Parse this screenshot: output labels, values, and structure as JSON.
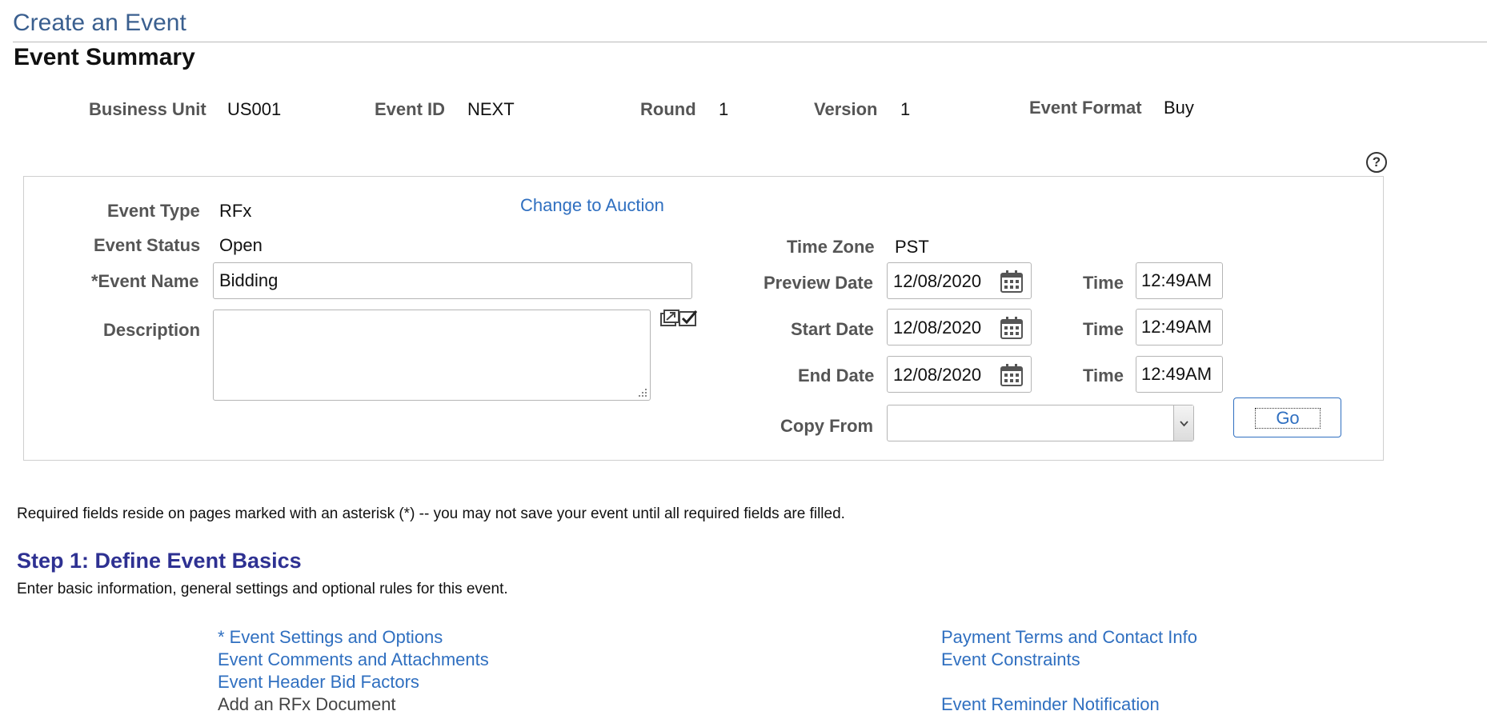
{
  "page": {
    "title": "Create an Event",
    "section_title": "Event Summary"
  },
  "summary": {
    "business_unit_label": "Business Unit",
    "business_unit_value": "US001",
    "event_id_label": "Event ID",
    "event_id_value": "NEXT",
    "round_label": "Round",
    "round_value": "1",
    "version_label": "Version",
    "version_value": "1",
    "event_format_label": "Event Format",
    "event_format_value": "Buy",
    "help_glyph": "?"
  },
  "details": {
    "event_type_label": "Event Type",
    "event_type_value": "RFx",
    "change_link": "Change to Auction",
    "event_status_label": "Event Status",
    "event_status_value": "Open",
    "time_zone_label": "Time Zone",
    "time_zone_value": "PST",
    "event_name_label": "*Event Name",
    "event_name_value": "Bidding",
    "description_label": "Description",
    "description_value": "",
    "preview_date_label": "Preview Date",
    "preview_date_value": "12/08/2020",
    "preview_time_label": "Time",
    "preview_time_value": "12:49AM",
    "start_date_label": "Start Date",
    "start_date_value": "12/08/2020",
    "start_time_label": "Time",
    "start_time_value": "12:49AM",
    "end_date_label": "End Date",
    "end_date_value": "12/08/2020",
    "end_time_label": "Time",
    "end_time_value": "12:49AM",
    "copy_from_label": "Copy From",
    "copy_from_value": "",
    "go_label": "Go"
  },
  "notes": {
    "required_text": "Required fields reside on pages marked with an asterisk (*) -- you may not save your event until all required fields are filled."
  },
  "step1": {
    "title": "Step 1: Define Event Basics",
    "subtitle": "Enter basic information, general settings and optional rules for this event.",
    "links_left": [
      "* Event Settings and Options",
      "Event Comments and Attachments",
      "Event Header Bid Factors",
      "Add an RFx Document"
    ],
    "links_right": [
      "Payment Terms and Contact Info",
      "Event Constraints",
      "Event Reminder Notification"
    ]
  },
  "colors": {
    "link": "#2f6fc0",
    "page_title": "#3a5f8f",
    "step_title": "#2e3192",
    "label": "#555555"
  },
  "icons": {
    "help": "help-icon",
    "calendar": "calendar-icon",
    "spellcheck": "spell-check-icon",
    "expand": "expand-text-icon",
    "dropdown": "chevron-down-icon"
  }
}
